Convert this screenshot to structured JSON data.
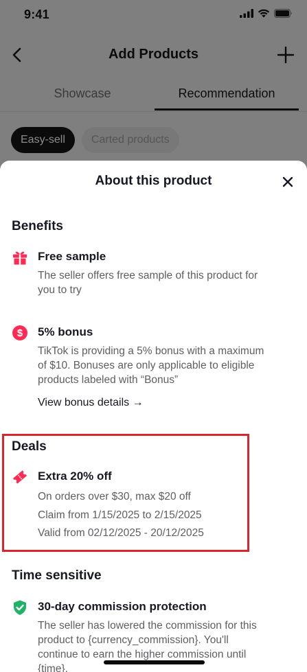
{
  "status_bar": {
    "time": "9:41"
  },
  "nav": {
    "title": "Add Products"
  },
  "tabs": [
    {
      "label": "Showcase",
      "selected": false
    },
    {
      "label": "Recommendation",
      "selected": true
    }
  ],
  "chips": [
    {
      "label": "Easy-sell",
      "selected": true
    },
    {
      "label": "Carted products",
      "selected": false
    }
  ],
  "sheet": {
    "title": "About this product",
    "benefits": {
      "heading": "Benefits",
      "items": [
        {
          "icon": "gift-icon",
          "title": "Free sample",
          "lines": [
            "The seller offers free sample of this product for",
            "you to try"
          ]
        },
        {
          "icon": "dollar-coin-icon",
          "title": "5% bonus",
          "lines": [
            "TikTok is providing a 5% bonus with a maximum",
            "of $10. Bonuses are only applicable to eligible",
            "products labeled with “Bonus”"
          ],
          "link": "View bonus details →"
        }
      ]
    },
    "deals": {
      "heading": "Deals",
      "item": {
        "icon": "ticket-icon",
        "title": "Extra 20% off",
        "lines": [
          "On orders over $30, max $20 off",
          "Claim from 1/15/2025 to 2/15/2025",
          "Valid from 02/12/2025 - 20/12/2025"
        ]
      }
    },
    "time_sensitive": {
      "heading": "Time sensitive",
      "item": {
        "icon": "shield-check-icon",
        "title": "30-day commission protection",
        "lines": [
          "The seller has lowered the commission for this",
          "product to {currency_commission}. You'll",
          "continue to earn the higher commission until",
          "{time}."
        ]
      }
    }
  },
  "colors": {
    "accent": "#FE2C55",
    "shield": "#20B267",
    "highlight_box": "#D7262E",
    "overlay": "#7F7F7F"
  }
}
